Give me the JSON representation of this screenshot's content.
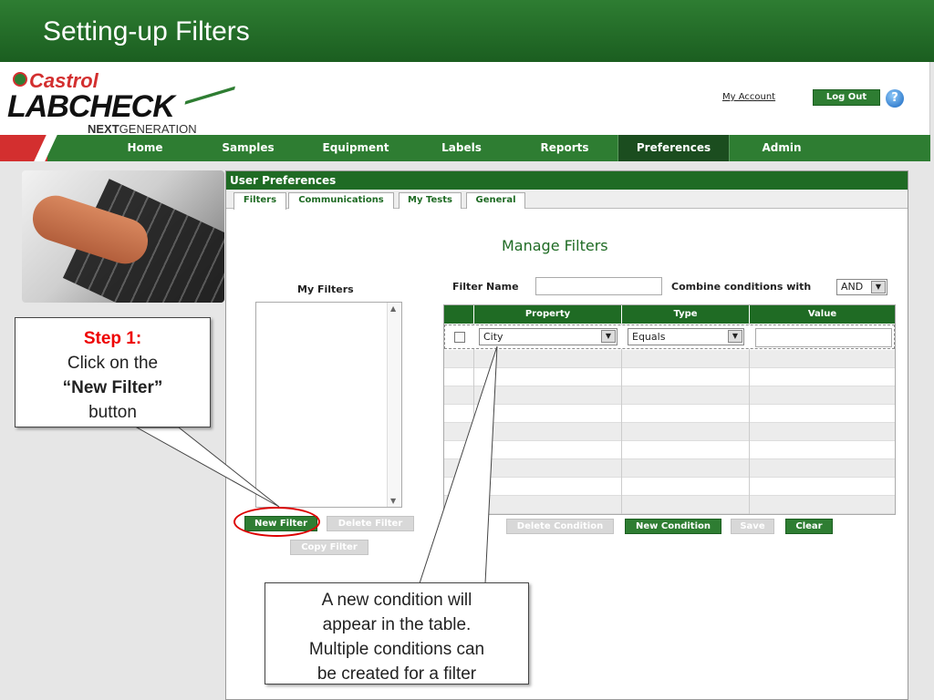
{
  "slide": {
    "title": "Setting-up Filters"
  },
  "header": {
    "logo_brand": "Castrol",
    "logo_product": "LABCHECK",
    "logo_next": "NEXT",
    "logo_generation": "GENERATION",
    "my_account": "My Account",
    "logout": "Log Out",
    "help_glyph": "?"
  },
  "nav": {
    "items": [
      "Home",
      "Samples",
      "Equipment",
      "Labels",
      "Reports",
      "Preferences",
      "Admin"
    ],
    "active": "Preferences"
  },
  "panel": {
    "title": "User Preferences",
    "tabs": [
      "Filters",
      "Communications",
      "My Tests",
      "General"
    ],
    "active_tab": "Filters",
    "heading": "Manage Filters",
    "my_filters_label": "My Filters",
    "filter_name_label": "Filter Name",
    "filter_name_value": "",
    "combine_label": "Combine conditions with",
    "combine_value": "AND",
    "buttons": {
      "new_filter": "New Filter",
      "delete_filter": "Delete Filter",
      "copy_filter": "Copy Filter",
      "delete_condition": "Delete Condition",
      "new_condition": "New Condition",
      "save": "Save",
      "clear": "Clear"
    },
    "table": {
      "headers": [
        "Property",
        "Type",
        "Value"
      ],
      "rows": [
        {
          "property": "City",
          "type": "Equals",
          "value": ""
        }
      ]
    }
  },
  "callouts": {
    "step1": {
      "step": "Step 1:",
      "line1": "Click on the",
      "bold": "“New Filter”",
      "line3": "button"
    },
    "step2": {
      "line1": "A new condition will",
      "line2": "appear in the table.",
      "line3": "Multiple conditions can",
      "line4": "be created for a filter"
    }
  },
  "colors": {
    "brand_green": "#2e7d32",
    "brand_red": "#d32f2f",
    "callout_step_red": "#e00000"
  }
}
